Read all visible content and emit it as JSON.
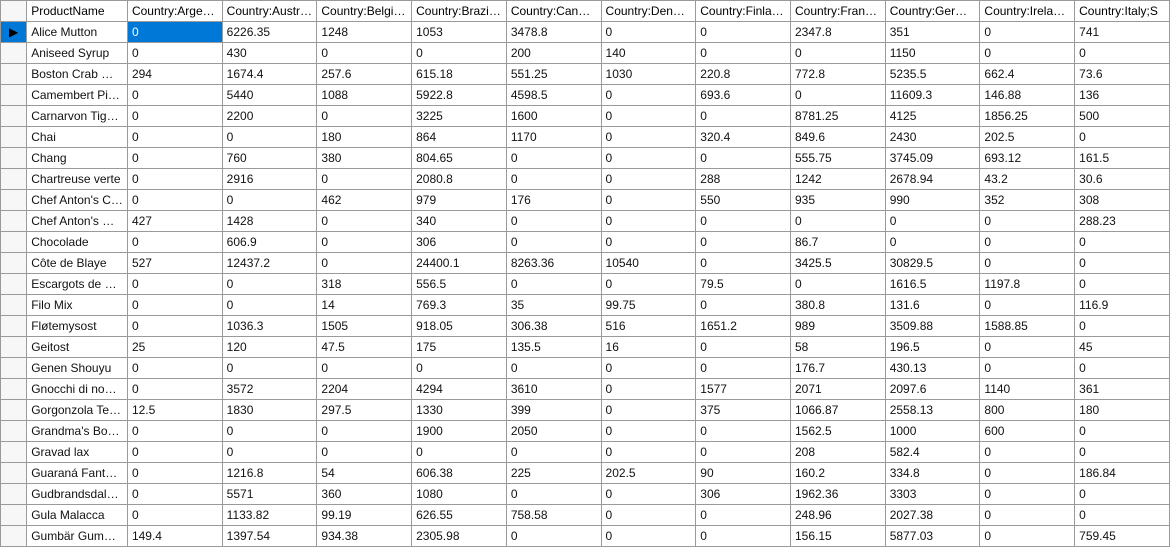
{
  "row_indicator_selected": "▶",
  "columns": [
    "ProductName",
    "Country:Argentina;S",
    "Country:Austria;Sale",
    "Country:Belgium;Sa",
    "Country:Brazil;Sales",
    "Country:Canada;Sa",
    "Country:Denmark;S",
    "Country:Finland;Sal",
    "Country:France;Sal",
    "Country:Germany;S",
    "Country:Ireland;Sal",
    "Country:Italy;S"
  ],
  "selected_row": 0,
  "selected_col": 1,
  "rows": [
    {
      "product": "Alice Mutton",
      "v": [
        "0",
        "6226.35",
        "1248",
        "1053",
        "3478.8",
        "0",
        "0",
        "2347.8",
        "351",
        "0",
        "741"
      ]
    },
    {
      "product": "Aniseed Syrup",
      "v": [
        "0",
        "430",
        "0",
        "0",
        "200",
        "140",
        "0",
        "0",
        "1150",
        "0",
        "0"
      ]
    },
    {
      "product": "Boston Crab Meat",
      "v": [
        "294",
        "1674.4",
        "257.6",
        "615.18",
        "551.25",
        "1030",
        "220.8",
        "772.8",
        "5235.5",
        "662.4",
        "73.6"
      ]
    },
    {
      "product": "Camembert Pierrot",
      "v": [
        "0",
        "5440",
        "1088",
        "5922.8",
        "4598.5",
        "0",
        "693.6",
        "0",
        "11609.3",
        "146.88",
        "136"
      ]
    },
    {
      "product": "Carnarvon Tigers",
      "v": [
        "0",
        "2200",
        "0",
        "3225",
        "1600",
        "0",
        "0",
        "8781.25",
        "4125",
        "1856.25",
        "500"
      ]
    },
    {
      "product": "Chai",
      "v": [
        "0",
        "0",
        "180",
        "864",
        "1170",
        "0",
        "320.4",
        "849.6",
        "2430",
        "202.5",
        "0"
      ]
    },
    {
      "product": "Chang",
      "v": [
        "0",
        "760",
        "380",
        "804.65",
        "0",
        "0",
        "0",
        "555.75",
        "3745.09",
        "693.12",
        "161.5"
      ]
    },
    {
      "product": "Chartreuse verte",
      "v": [
        "0",
        "2916",
        "0",
        "2080.8",
        "0",
        "0",
        "288",
        "1242",
        "2678.94",
        "43.2",
        "30.6"
      ]
    },
    {
      "product": "Chef Anton's Caj...",
      "v": [
        "0",
        "0",
        "462",
        "979",
        "176",
        "0",
        "550",
        "935",
        "990",
        "352",
        "308"
      ]
    },
    {
      "product": "Chef Anton's Gu...",
      "v": [
        "427",
        "1428",
        "0",
        "340",
        "0",
        "0",
        "0",
        "0",
        "0",
        "0",
        "288.23"
      ]
    },
    {
      "product": "Chocolade",
      "v": [
        "0",
        "606.9",
        "0",
        "306",
        "0",
        "0",
        "0",
        "86.7",
        "0",
        "0",
        "0"
      ]
    },
    {
      "product": "Côte de Blaye",
      "v": [
        "527",
        "12437.2",
        "0",
        "24400.1",
        "8263.36",
        "10540",
        "0",
        "3425.5",
        "30829.5",
        "0",
        "0"
      ]
    },
    {
      "product": "Escargots de Bo...",
      "v": [
        "0",
        "0",
        "318",
        "556.5",
        "0",
        "0",
        "79.5",
        "0",
        "1616.5",
        "1197.8",
        "0"
      ]
    },
    {
      "product": "Filo Mix",
      "v": [
        "0",
        "0",
        "14",
        "769.3",
        "35",
        "99.75",
        "0",
        "380.8",
        "131.6",
        "0",
        "116.9"
      ]
    },
    {
      "product": "Fløtemysost",
      "v": [
        "0",
        "1036.3",
        "1505",
        "918.05",
        "306.38",
        "516",
        "1651.2",
        "989",
        "3509.88",
        "1588.85",
        "0"
      ]
    },
    {
      "product": "Geitost",
      "v": [
        "25",
        "120",
        "47.5",
        "175",
        "135.5",
        "16",
        "0",
        "58",
        "196.5",
        "0",
        "45"
      ]
    },
    {
      "product": "Genen Shouyu",
      "v": [
        "0",
        "0",
        "0",
        "0",
        "0",
        "0",
        "0",
        "176.7",
        "430.13",
        "0",
        "0"
      ]
    },
    {
      "product": "Gnocchi di nonn...",
      "v": [
        "0",
        "3572",
        "2204",
        "4294",
        "3610",
        "0",
        "1577",
        "2071",
        "2097.6",
        "1140",
        "361"
      ]
    },
    {
      "product": "Gorgonzola Telino",
      "v": [
        "12.5",
        "1830",
        "297.5",
        "1330",
        "399",
        "0",
        "375",
        "1066.87",
        "2558.13",
        "800",
        "180"
      ]
    },
    {
      "product": "Grandma's Boyse...",
      "v": [
        "0",
        "0",
        "0",
        "1900",
        "2050",
        "0",
        "0",
        "1562.5",
        "1000",
        "600",
        "0"
      ]
    },
    {
      "product": "Gravad lax",
      "v": [
        "0",
        "0",
        "0",
        "0",
        "0",
        "0",
        "0",
        "208",
        "582.4",
        "0",
        "0"
      ]
    },
    {
      "product": "Guaraná Fantásti...",
      "v": [
        "0",
        "1216.8",
        "54",
        "606.38",
        "225",
        "202.5",
        "90",
        "160.2",
        "334.8",
        "0",
        "186.84"
      ]
    },
    {
      "product": "Gudbrandsdalsost",
      "v": [
        "0",
        "5571",
        "360",
        "1080",
        "0",
        "0",
        "306",
        "1962.36",
        "3303",
        "0",
        "0"
      ]
    },
    {
      "product": "Gula Malacca",
      "v": [
        "0",
        "1133.82",
        "99.19",
        "626.55",
        "758.58",
        "0",
        "0",
        "248.96",
        "2027.38",
        "0",
        "0"
      ]
    },
    {
      "product": "Gumbär Gummib...",
      "v": [
        "149.4",
        "1397.54",
        "934.38",
        "2305.98",
        "0",
        "0",
        "0",
        "156.15",
        "5877.03",
        "0",
        "759.45"
      ]
    }
  ]
}
